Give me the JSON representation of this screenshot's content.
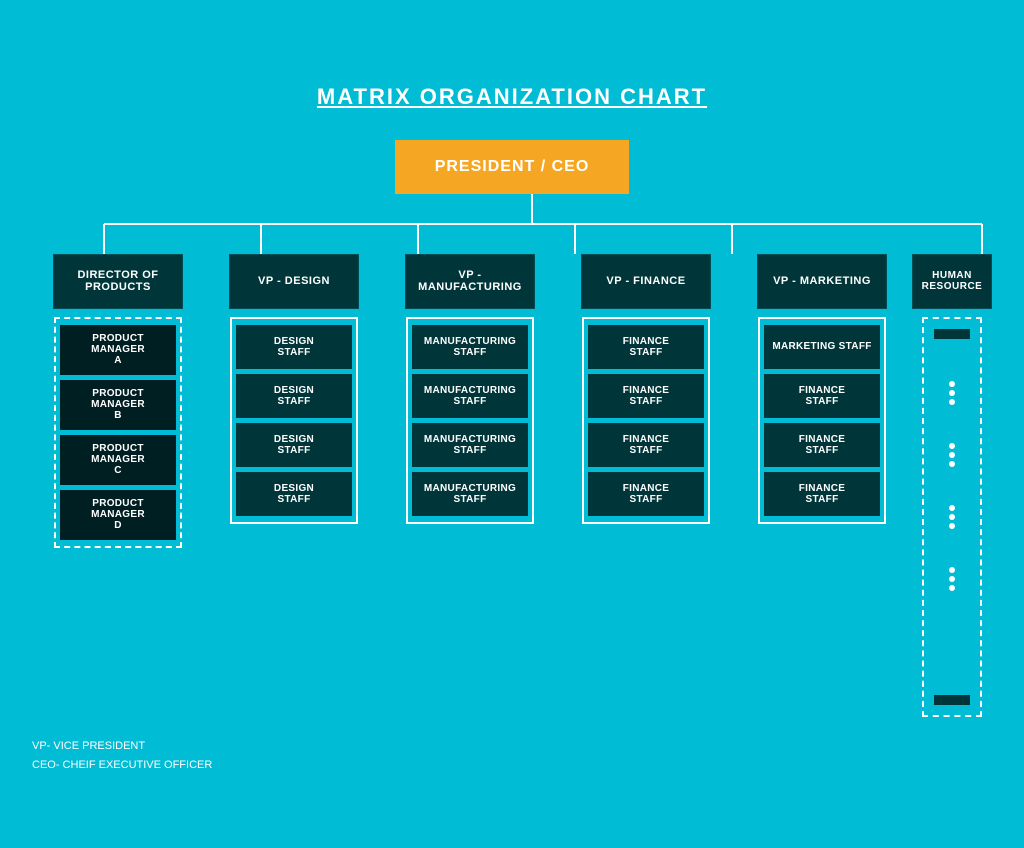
{
  "title": "MATRIX ORGANIZATION CHART",
  "ceo": {
    "label": "PRESIDENT / CEO"
  },
  "columns": [
    {
      "id": "director",
      "vp_label": "DIRECTOR OF\nPRODUCTS",
      "border_style": "dashed",
      "staff": [
        "PRODUCT\nMANAGER\nA",
        "PRODUCT\nMANAGER\nB",
        "PRODUCT\nMANAGER\nC",
        "PRODUCT\nMANAGER\nD"
      ]
    },
    {
      "id": "design",
      "vp_label": "VP - DESIGN",
      "border_style": "solid",
      "staff": [
        "DESIGN\nSTAFF",
        "DESIGN\nSTAFF",
        "DESIGN\nSTAFF",
        "DESIGN\nSTAFF"
      ]
    },
    {
      "id": "manufacturing",
      "vp_label": "VP -\nMANUFACTURING",
      "border_style": "solid",
      "staff": [
        "MANUFACTURING\nSTAFF",
        "MANUFACTURING\nSTAFF",
        "MANUFACTURING\nSTAFF",
        "MANUFACTURING\nSTAFF"
      ]
    },
    {
      "id": "finance",
      "vp_label": "VP - FINANCE",
      "border_style": "solid",
      "staff": [
        "FINANCE\nSTAFF",
        "FINANCE\nSTAFF",
        "FINANCE\nSTAFF",
        "FINANCE\nSTAFF"
      ]
    },
    {
      "id": "marketing",
      "vp_label": "VP - MARKETING",
      "border_style": "solid",
      "staff": [
        "MARKETING STAFF",
        "FINANCE\nSTAFF",
        "FINANCE\nSTAFF",
        "FINANCE\nSTAFF"
      ]
    },
    {
      "id": "hr",
      "vp_label": "HUMAN\nRESOURCE",
      "border_style": "dashed",
      "is_hr": true
    }
  ],
  "legend": {
    "line1": "VP- VICE PRESIDENT",
    "line2": "CEO- CHEIF EXECUTIVE OFFICER"
  },
  "colors": {
    "background": "#00BCD4",
    "ceo_box": "#F5A623",
    "dark_box": "#00363A",
    "very_dark_box": "#001f22",
    "white": "#FFFFFF",
    "connector": "#FFFFFF"
  }
}
